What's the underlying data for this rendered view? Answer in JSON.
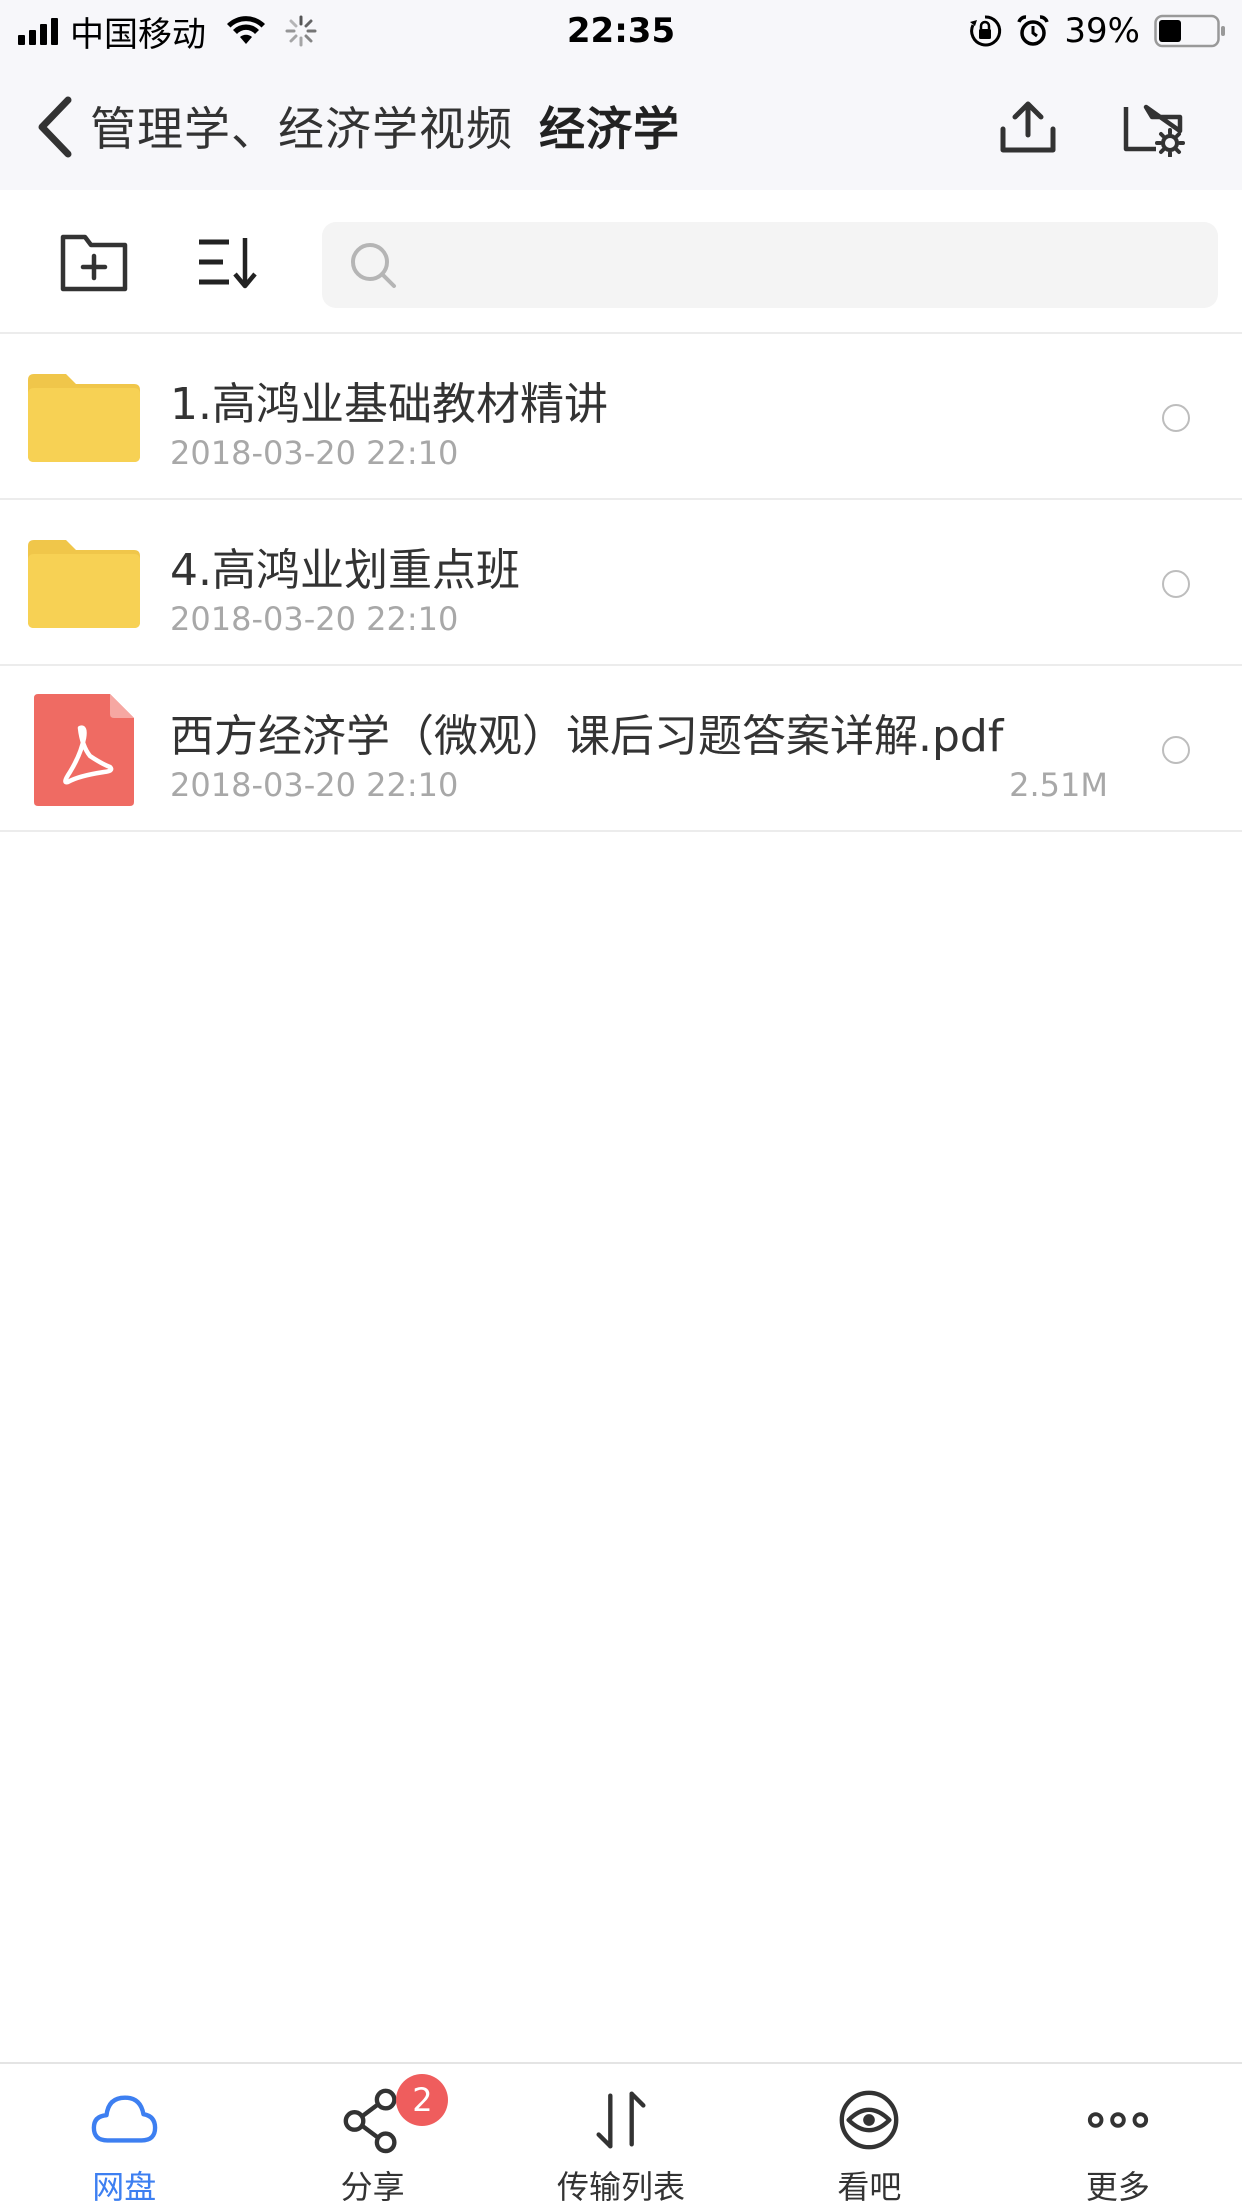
{
  "status_bar": {
    "carrier": "中国移动",
    "time": "22:35",
    "battery_percent": "39%",
    "battery_level": 0.39
  },
  "header": {
    "parent_folder": "管理学、经济学视频",
    "current_folder": "经济学"
  },
  "search": {
    "value": "",
    "placeholder": ""
  },
  "files": [
    {
      "type": "folder",
      "name": "1.高鸿业基础教材精讲",
      "date": "2018-03-20 22:10",
      "size": ""
    },
    {
      "type": "folder",
      "name": "4.高鸿业划重点班",
      "date": "2018-03-20 22:10",
      "size": ""
    },
    {
      "type": "pdf",
      "name": "西方经济学（微观）课后习题答案详解.pdf",
      "date": "2018-03-20 22:10",
      "size": "2.51M"
    }
  ],
  "tabs": [
    {
      "label": "网盘",
      "icon": "cloud-icon",
      "active": true
    },
    {
      "label": "分享",
      "icon": "share-icon",
      "badge": "2"
    },
    {
      "label": "传输列表",
      "icon": "transfer-icon"
    },
    {
      "label": "看吧",
      "icon": "eye-icon"
    },
    {
      "label": "更多",
      "icon": "more-icon"
    }
  ],
  "colors": {
    "accent": "#3d7ff1",
    "folder": "#f7d154",
    "pdf": "#ef6b63",
    "badge": "#ef5d5d"
  }
}
